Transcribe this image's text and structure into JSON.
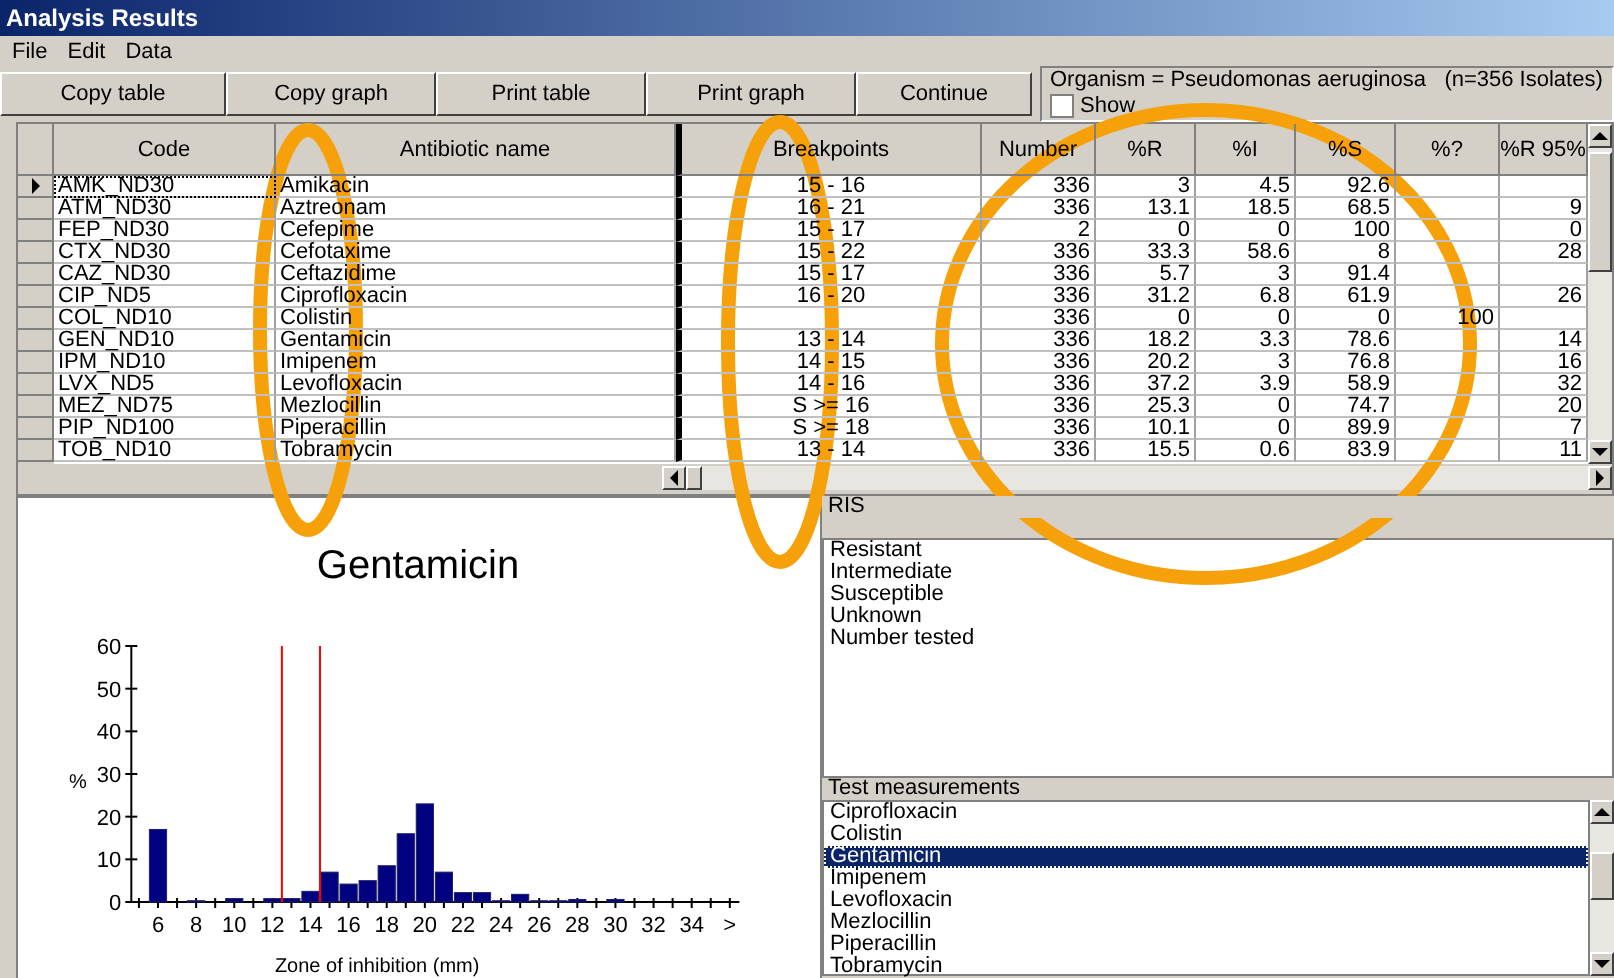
{
  "window": {
    "title": "Analysis Results"
  },
  "menu": [
    "File",
    "Edit",
    "Data"
  ],
  "toolbar": {
    "buttons": [
      "Copy table",
      "Copy graph",
      "Print table",
      "Print graph",
      "Continue"
    ],
    "organism": "Organism = Pseudomonas aeruginosa   (n=356 Isolates)",
    "checkbox": {
      "label": "Show",
      "checked": false
    }
  },
  "table": {
    "columns": [
      "Code",
      "Antibiotic name",
      "Breakpoints",
      "Number",
      "%R",
      "%I",
      "%S",
      "%?",
      "%R 95%"
    ],
    "rows": [
      {
        "selected": true,
        "cells": [
          "AMK_ND30",
          "Amikacin",
          "15 - 16",
          "336",
          "3",
          "4.5",
          "92.6",
          "",
          ""
        ]
      },
      {
        "selected": false,
        "cells": [
          "ATM_ND30",
          "Aztreonam",
          "16 - 21",
          "336",
          "13.1",
          "18.5",
          "68.5",
          "",
          "9"
        ]
      },
      {
        "selected": false,
        "cells": [
          "FEP_ND30",
          "Cefepime",
          "15 - 17",
          "2",
          "0",
          "0",
          "100",
          "",
          "0"
        ]
      },
      {
        "selected": false,
        "cells": [
          "CTX_ND30",
          "Cefotaxime",
          "15 - 22",
          "336",
          "33.3",
          "58.6",
          "8",
          "",
          "28"
        ]
      },
      {
        "selected": false,
        "cells": [
          "CAZ_ND30",
          "Ceftazidime",
          "15 - 17",
          "336",
          "5.7",
          "3",
          "91.4",
          "",
          ""
        ]
      },
      {
        "selected": false,
        "cells": [
          "CIP_ND5",
          "Ciprofloxacin",
          "16 - 20",
          "336",
          "31.2",
          "6.8",
          "61.9",
          "",
          "26"
        ]
      },
      {
        "selected": false,
        "cells": [
          "COL_ND10",
          "Colistin",
          "",
          "336",
          "0",
          "0",
          "0",
          "100",
          ""
        ]
      },
      {
        "selected": false,
        "cells": [
          "GEN_ND10",
          "Gentamicin",
          "13 - 14",
          "336",
          "18.2",
          "3.3",
          "78.6",
          "",
          "14"
        ]
      },
      {
        "selected": false,
        "cells": [
          "IPM_ND10",
          "Imipenem",
          "14 - 15",
          "336",
          "20.2",
          "3",
          "76.8",
          "",
          "16"
        ]
      },
      {
        "selected": false,
        "cells": [
          "LVX_ND5",
          "Levofloxacin",
          "14 - 16",
          "336",
          "37.2",
          "3.9",
          "58.9",
          "",
          "32"
        ]
      },
      {
        "selected": false,
        "cells": [
          "MEZ_ND75",
          "Mezlocillin",
          "S >= 16",
          "336",
          "25.3",
          "0",
          "74.7",
          "",
          "20"
        ]
      },
      {
        "selected": false,
        "cells": [
          "PIP_ND100",
          "Piperacillin",
          "S >= 18",
          "336",
          "10.1",
          "0",
          "89.9",
          "",
          "7"
        ]
      },
      {
        "selected": false,
        "cells": [
          "TOB_ND10",
          "Tobramycin",
          "13 - 14",
          "336",
          "15.5",
          "0.6",
          "83.9",
          "",
          "11"
        ]
      }
    ]
  },
  "chart": {
    "chart_data": {
      "type": "bar",
      "title": "Gentamicin",
      "xlabel": "Zone of inhibition (mm)",
      "ylabel": "%",
      "x": [
        5,
        6,
        7,
        8,
        9,
        10,
        11,
        12,
        13,
        14,
        15,
        16,
        17,
        18,
        19,
        20,
        21,
        22,
        23,
        24,
        25,
        26,
        27,
        28,
        29,
        30,
        31,
        32,
        33,
        34,
        35,
        36
      ],
      "values": [
        0,
        17,
        0,
        0.3,
        0,
        0.8,
        0,
        0.8,
        0.8,
        2.5,
        7,
        4.2,
        5,
        8.5,
        16,
        23,
        7,
        2.2,
        2.2,
        0.3,
        1.8,
        0.3,
        0.3,
        0.6,
        0,
        0.6,
        0,
        0,
        0,
        0,
        0,
        0
      ],
      "xlim": [
        4.6,
        36.5
      ],
      "ylim": [
        0,
        60
      ],
      "yticks": [
        0,
        10,
        20,
        30,
        40,
        50,
        60
      ],
      "xticks": [
        {
          "value": 6,
          "label": "6"
        },
        {
          "value": 8,
          "label": "8"
        },
        {
          "value": 10,
          "label": "10"
        },
        {
          "value": 12,
          "label": "12"
        },
        {
          "value": 14,
          "label": "14"
        },
        {
          "value": 16,
          "label": "16"
        },
        {
          "value": 18,
          "label": "18"
        },
        {
          "value": 20,
          "label": "20"
        },
        {
          "value": 22,
          "label": "22"
        },
        {
          "value": 24,
          "label": "24"
        },
        {
          "value": 26,
          "label": "26"
        },
        {
          "value": 28,
          "label": "28"
        },
        {
          "value": 30,
          "label": "30"
        },
        {
          "value": 32,
          "label": "32"
        },
        {
          "value": 34,
          "label": "34"
        },
        {
          "value": 36,
          "label": ">"
        }
      ],
      "ref_lines": [
        {
          "axis": "x",
          "value": 12.5
        },
        {
          "axis": "x",
          "value": 14.5
        }
      ]
    }
  },
  "ris": {
    "header": "RIS",
    "items": [
      "Resistant",
      "Intermediate",
      "Susceptible",
      "Unknown",
      "Number tested"
    ]
  },
  "tests": {
    "header": "Test measurements",
    "items": [
      {
        "label": "Ciprofloxacin",
        "selected": false
      },
      {
        "label": "Colistin",
        "selected": false
      },
      {
        "label": "Gentamicin",
        "selected": true
      },
      {
        "label": "Imipenem",
        "selected": false
      },
      {
        "label": "Levofloxacin",
        "selected": false
      },
      {
        "label": "Mezlocillin",
        "selected": false
      },
      {
        "label": "Piperacillin",
        "selected": false
      },
      {
        "label": "Tobramycin",
        "selected": false
      }
    ]
  }
}
